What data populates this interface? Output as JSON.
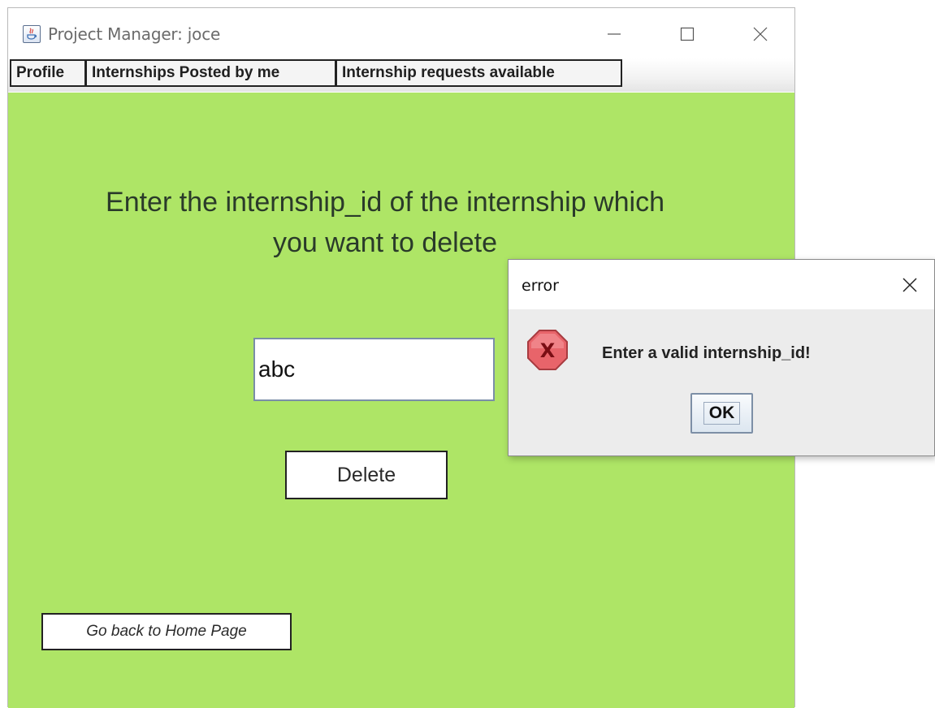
{
  "window": {
    "title": "Project Manager: joce"
  },
  "tabs": [
    {
      "label": "Profile"
    },
    {
      "label": "Internships Posted by me"
    },
    {
      "label": "Internship requests available"
    }
  ],
  "main": {
    "prompt_line1": "Enter the internship_id of the internship which",
    "prompt_line2": "you want to delete",
    "input_value": "abc",
    "delete_label": "Delete",
    "home_label": "Go back to Home Page",
    "background_color": "#aee566"
  },
  "dialog": {
    "title": "error",
    "message": "Enter a valid internship_id!",
    "ok_label": "OK",
    "icon": "error-icon",
    "icon_color": "#e8646a"
  }
}
